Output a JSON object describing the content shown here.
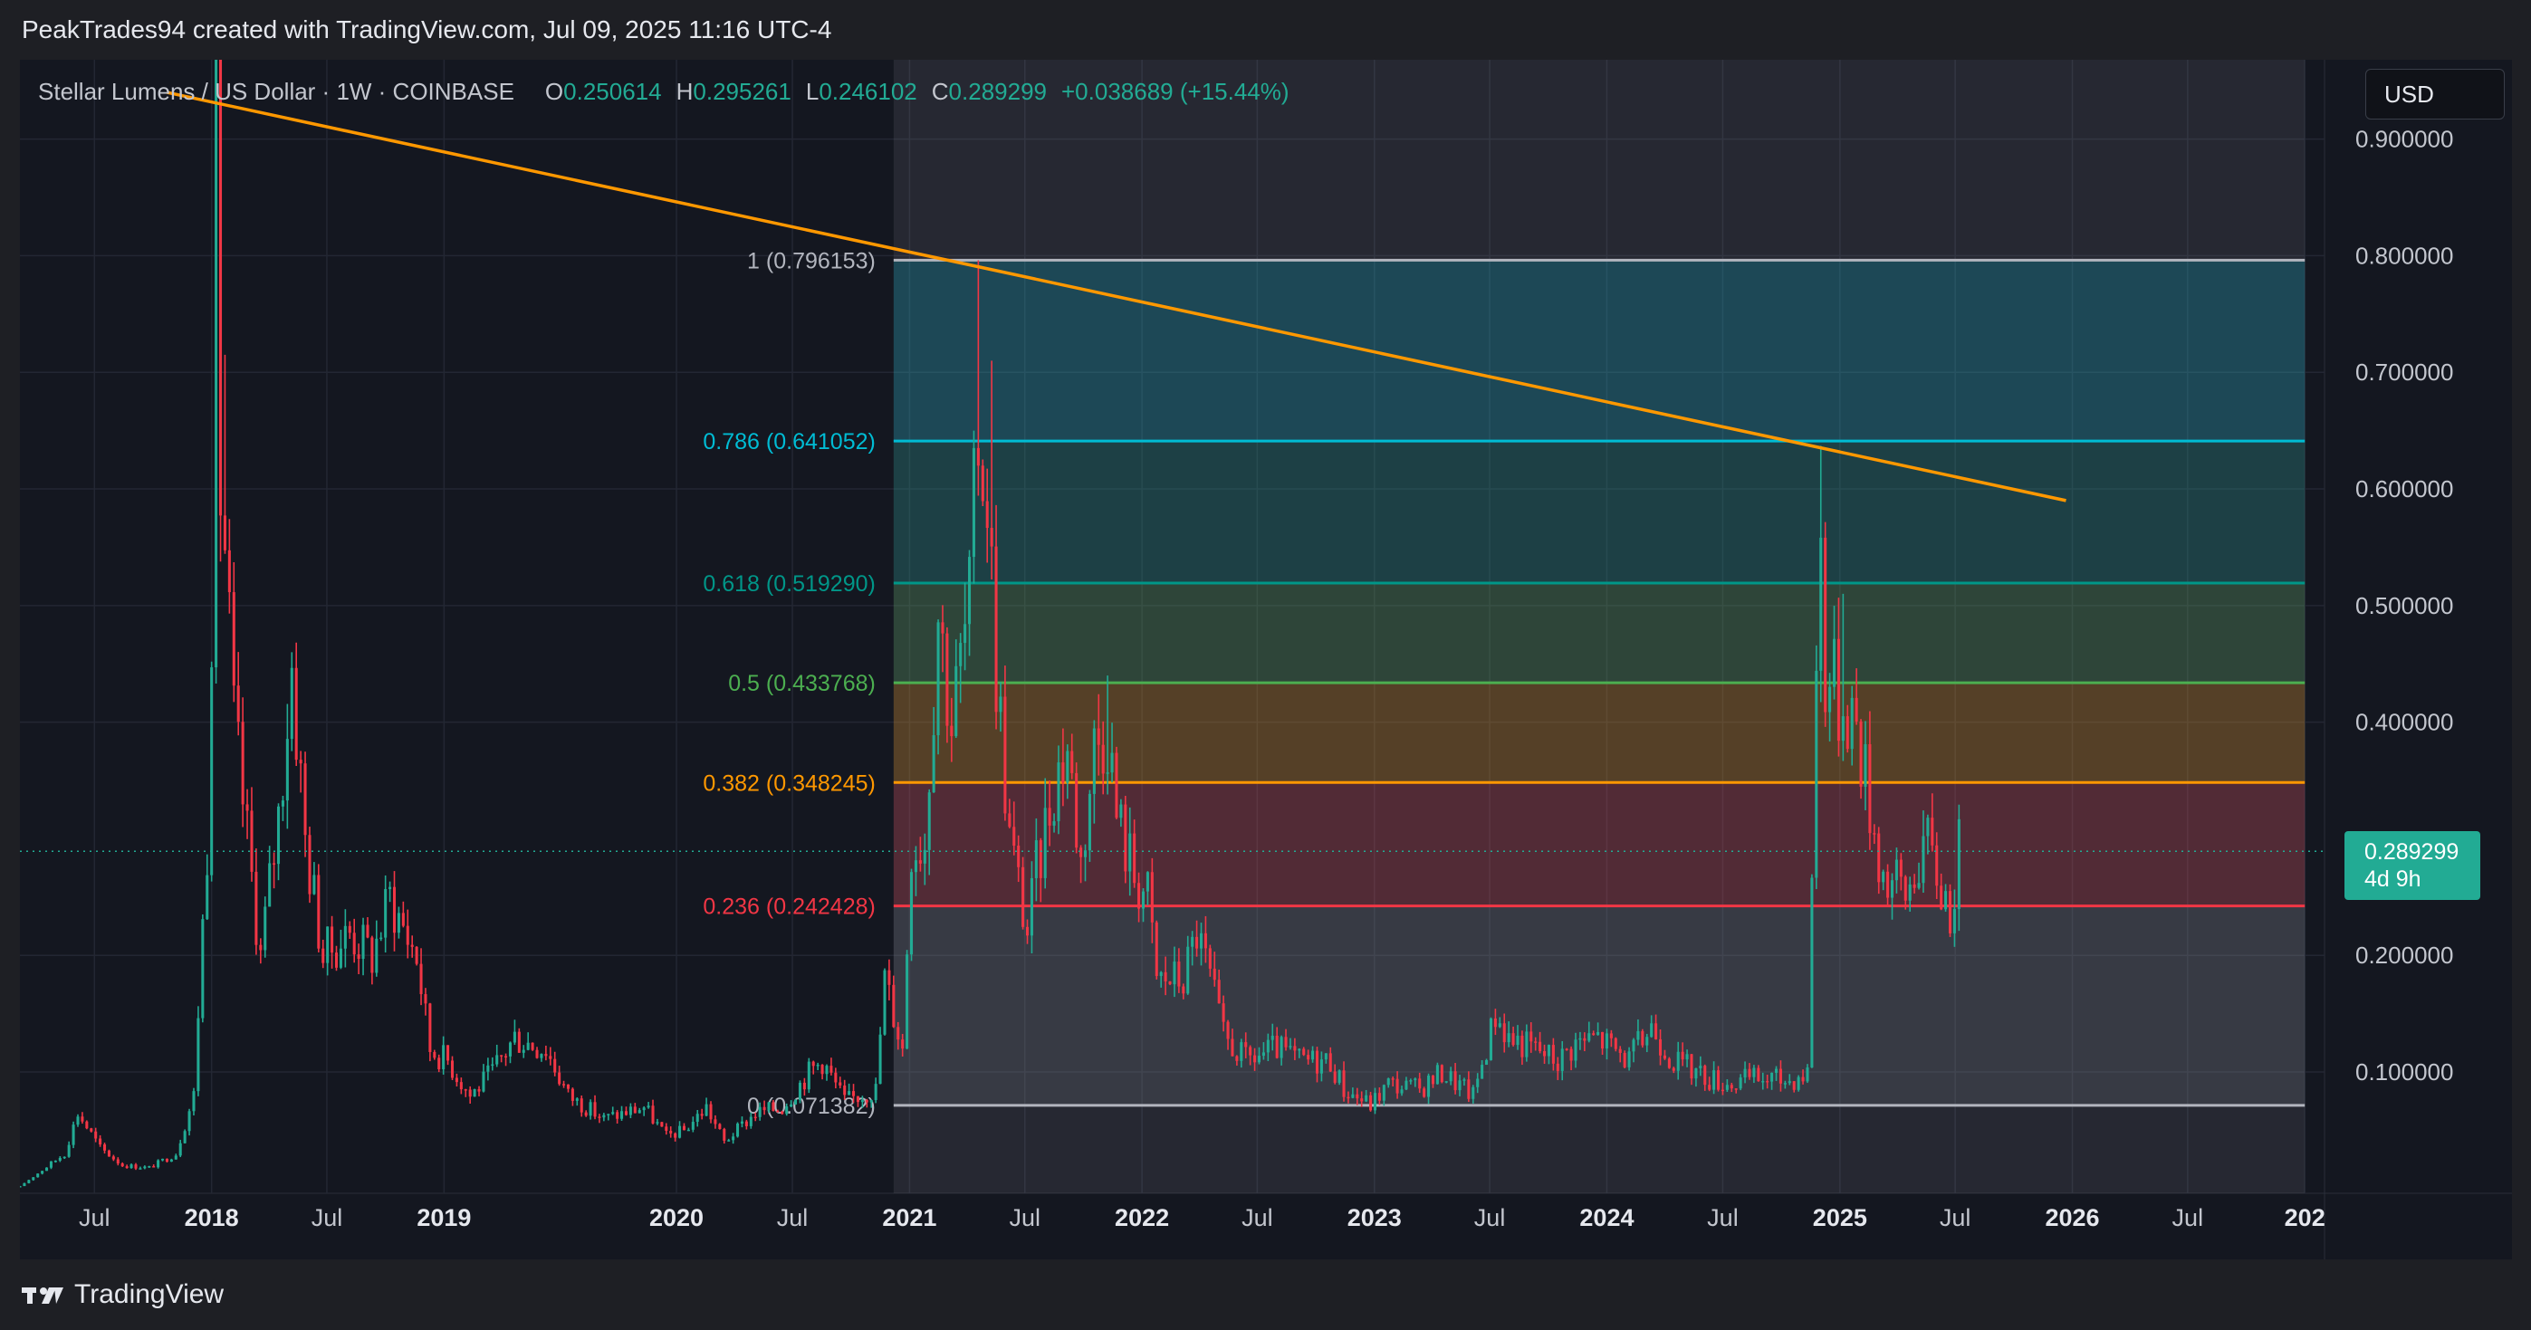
{
  "header": {
    "credit": "PeakTrades94 created with TradingView.com, Jul 09, 2025 11:16 UTC-4"
  },
  "legend": {
    "symbol": "Stellar Lumens / US Dollar · 1W · COINBASE",
    "o_label": "O",
    "o": "0.250614",
    "h_label": "H",
    "h": "0.295261",
    "l_label": "L",
    "l": "0.246102",
    "c_label": "C",
    "c": "0.289299",
    "change": "+0.038689 (+15.44%)"
  },
  "currency_button": "USD",
  "last_price": {
    "value": "0.289299",
    "countdown": "4d 9h"
  },
  "footer": {
    "brand": "TradingView"
  },
  "colors": {
    "up": "#22ab94",
    "down": "#f23645",
    "trendline": "#ff9800",
    "fib_1": "#b2b5be",
    "fib_786": "#00bcd4",
    "fib_618": "#009688",
    "fib_5": "#4caf50",
    "fib_382": "#ff9800",
    "fib_236": "#f23645",
    "fib_0": "#b2b5be"
  },
  "chart_data": {
    "type": "candlestick",
    "symbol": "XLMUSD",
    "interval": "1W",
    "exchange": "COINBASE",
    "y_axis": {
      "position": "right",
      "ticks": [
        "0.900000",
        "0.800000",
        "0.700000",
        "0.600000",
        "0.500000",
        "0.400000",
        "0.200000",
        "0.100000"
      ],
      "tick_values": [
        0.9,
        0.8,
        0.7,
        0.6,
        0.5,
        0.4,
        0.2,
        0.1
      ],
      "range": [
        -0.004,
        0.968
      ]
    },
    "x_axis": {
      "ticks": [
        {
          "label": "Jul",
          "date": "2017-07-01",
          "bold": false
        },
        {
          "label": "2018",
          "date": "2018-01-01",
          "bold": true
        },
        {
          "label": "Jul",
          "date": "2018-07-01",
          "bold": false
        },
        {
          "label": "2019",
          "date": "2019-01-01",
          "bold": true
        },
        {
          "label": "2020",
          "date": "2020-01-01",
          "bold": true
        },
        {
          "label": "Jul",
          "date": "2020-07-01",
          "bold": false
        },
        {
          "label": "2021",
          "date": "2021-01-01",
          "bold": true
        },
        {
          "label": "Jul",
          "date": "2021-07-01",
          "bold": false
        },
        {
          "label": "2022",
          "date": "2022-01-01",
          "bold": true
        },
        {
          "label": "Jul",
          "date": "2022-07-01",
          "bold": false
        },
        {
          "label": "2023",
          "date": "2023-01-01",
          "bold": true
        },
        {
          "label": "Jul",
          "date": "2023-07-01",
          "bold": false
        },
        {
          "label": "2024",
          "date": "2024-01-01",
          "bold": true
        },
        {
          "label": "Jul",
          "date": "2024-07-01",
          "bold": false
        },
        {
          "label": "2025",
          "date": "2025-01-01",
          "bold": true
        },
        {
          "label": "Jul",
          "date": "2025-07-01",
          "bold": false
        },
        {
          "label": "2026",
          "date": "2026-01-01",
          "bold": true
        },
        {
          "label": "Jul",
          "date": "2026-07-01",
          "bold": false
        },
        {
          "label": "202",
          "date": "2027-01-01",
          "bold": true
        }
      ],
      "range": [
        "2017-03-06",
        "2027-02-01"
      ]
    },
    "price_path": [
      [
        "2017-03-06",
        0.002
      ],
      [
        "2017-05-15",
        0.03
      ],
      [
        "2017-06-05",
        0.065
      ],
      [
        "2017-07-10",
        0.035
      ],
      [
        "2017-08-14",
        0.02
      ],
      [
        "2017-09-25",
        0.018
      ],
      [
        "2017-11-06",
        0.03
      ],
      [
        "2017-12-04",
        0.08
      ],
      [
        "2017-12-25",
        0.3
      ],
      [
        "2018-01-01",
        0.5
      ],
      [
        "2018-01-08",
        0.93
      ],
      [
        "2018-01-15",
        0.6
      ],
      [
        "2018-01-22",
        0.55
      ],
      [
        "2018-02-05",
        0.4
      ],
      [
        "2018-02-26",
        0.3
      ],
      [
        "2018-03-19",
        0.2
      ],
      [
        "2018-04-16",
        0.32
      ],
      [
        "2018-05-07",
        0.45
      ],
      [
        "2018-05-28",
        0.3
      ],
      [
        "2018-06-25",
        0.2
      ],
      [
        "2018-08-06",
        0.22
      ],
      [
        "2018-09-10",
        0.2
      ],
      [
        "2018-10-08",
        0.25
      ],
      [
        "2018-11-19",
        0.2
      ],
      [
        "2018-12-10",
        0.12
      ],
      [
        "2019-01-07",
        0.11
      ],
      [
        "2019-02-11",
        0.08
      ],
      [
        "2019-03-18",
        0.1
      ],
      [
        "2019-04-22",
        0.13
      ],
      [
        "2019-06-10",
        0.12
      ],
      [
        "2019-07-15",
        0.08
      ],
      [
        "2019-09-09",
        0.06
      ],
      [
        "2019-11-11",
        0.07
      ],
      [
        "2019-12-16",
        0.045
      ],
      [
        "2020-01-13",
        0.05
      ],
      [
        "2020-02-17",
        0.07
      ],
      [
        "2020-03-16",
        0.04
      ],
      [
        "2020-05-04",
        0.065
      ],
      [
        "2020-06-15",
        0.07
      ],
      [
        "2020-07-27",
        0.1
      ],
      [
        "2020-08-17",
        0.11
      ],
      [
        "2020-09-21",
        0.075
      ],
      [
        "2020-11-09",
        0.085
      ],
      [
        "2020-11-23",
        0.18
      ],
      [
        "2020-12-07",
        0.15
      ],
      [
        "2020-12-21",
        0.12
      ],
      [
        "2021-01-04",
        0.3
      ],
      [
        "2021-01-25",
        0.3
      ],
      [
        "2021-02-15",
        0.5
      ],
      [
        "2021-03-08",
        0.4
      ],
      [
        "2021-04-05",
        0.5
      ],
      [
        "2021-04-19",
        0.65
      ],
      [
        "2021-05-03",
        0.6
      ],
      [
        "2021-05-17",
        0.45
      ],
      [
        "2021-06-07",
        0.3
      ],
      [
        "2021-07-05",
        0.22
      ],
      [
        "2021-07-19",
        0.27
      ],
      [
        "2021-08-16",
        0.35
      ],
      [
        "2021-09-06",
        0.38
      ],
      [
        "2021-09-27",
        0.28
      ],
      [
        "2021-10-18",
        0.38
      ],
      [
        "2021-11-08",
        0.4
      ],
      [
        "2021-11-22",
        0.32
      ],
      [
        "2021-12-20",
        0.27
      ],
      [
        "2022-01-10",
        0.25
      ],
      [
        "2022-01-24",
        0.18
      ],
      [
        "2022-03-07",
        0.18
      ],
      [
        "2022-03-28",
        0.22
      ],
      [
        "2022-04-18",
        0.18
      ],
      [
        "2022-05-09",
        0.13
      ],
      [
        "2022-06-13",
        0.11
      ],
      [
        "2022-08-01",
        0.12
      ],
      [
        "2022-09-05",
        0.11
      ],
      [
        "2022-10-24",
        0.11
      ],
      [
        "2022-11-14",
        0.085
      ],
      [
        "2022-12-26",
        0.072
      ],
      [
        "2023-01-23",
        0.09
      ],
      [
        "2023-03-13",
        0.085
      ],
      [
        "2023-04-17",
        0.1
      ],
      [
        "2023-06-05",
        0.08
      ],
      [
        "2023-07-10",
        0.15
      ],
      [
        "2023-07-31",
        0.13
      ],
      [
        "2023-09-11",
        0.12
      ],
      [
        "2023-10-16",
        0.11
      ],
      [
        "2023-11-13",
        0.125
      ],
      [
        "2023-12-18",
        0.13
      ],
      [
        "2024-02-05",
        0.11
      ],
      [
        "2024-03-11",
        0.14
      ],
      [
        "2024-04-15",
        0.11
      ],
      [
        "2024-06-10",
        0.095
      ],
      [
        "2024-07-15",
        0.09
      ],
      [
        "2024-08-19",
        0.095
      ],
      [
        "2024-10-14",
        0.093
      ],
      [
        "2024-11-11",
        0.1
      ],
      [
        "2024-11-18",
        0.28
      ],
      [
        "2024-11-25",
        0.45
      ],
      [
        "2024-12-02",
        0.55
      ],
      [
        "2024-12-09",
        0.45
      ],
      [
        "2024-12-30",
        0.42
      ],
      [
        "2025-01-13",
        0.42
      ],
      [
        "2025-01-27",
        0.4
      ],
      [
        "2025-02-17",
        0.33
      ],
      [
        "2025-03-10",
        0.27
      ],
      [
        "2025-03-31",
        0.26
      ],
      [
        "2025-04-14",
        0.25
      ],
      [
        "2025-05-12",
        0.3
      ],
      [
        "2025-06-02",
        0.27
      ],
      [
        "2025-06-23",
        0.24
      ],
      [
        "2025-07-07",
        0.289
      ]
    ],
    "spike_highs": [
      [
        "2018-01-08",
        0.938
      ],
      [
        "2018-01-22",
        0.715
      ],
      [
        "2018-05-07",
        0.46
      ],
      [
        "2021-04-19",
        0.796
      ],
      [
        "2021-05-10",
        0.71
      ],
      [
        "2021-11-08",
        0.44
      ],
      [
        "2024-12-02",
        0.637
      ],
      [
        "2025-01-06",
        0.51
      ]
    ],
    "fibonacci_retracement": {
      "start_date": "2020-12-07",
      "end_date": "2027-01-01",
      "levels": [
        {
          "ratio": 1,
          "price": 0.796153,
          "label": "1 (0.796153)",
          "color": "#b2b5be",
          "fill": "#00bcd4"
        },
        {
          "ratio": 0.786,
          "price": 0.641052,
          "label": "0.786 (0.641052)",
          "color": "#00bcd4",
          "fill": "#00bcd4"
        },
        {
          "ratio": 0.618,
          "price": 0.51929,
          "label": "0.618 (0.519290)",
          "color": "#009688",
          "fill": "#009688"
        },
        {
          "ratio": 0.5,
          "price": 0.433768,
          "label": "0.5 (0.433768)",
          "color": "#4caf50",
          "fill": "#4caf50"
        },
        {
          "ratio": 0.382,
          "price": 0.348245,
          "label": "0.382 (0.348245)",
          "color": "#ff9800",
          "fill": "#ff9800"
        },
        {
          "ratio": 0.236,
          "price": 0.242428,
          "label": "0.236 (0.242428)",
          "color": "#f23645",
          "fill": "#f23645"
        },
        {
          "ratio": 0,
          "price": 0.071382,
          "label": "0 (0.071382)",
          "color": "#b2b5be",
          "fill": "#787b86"
        }
      ]
    },
    "trendline": {
      "color": "#ff9800",
      "points": [
        [
          "2017-10-23",
          0.94
        ],
        [
          "2025-12-22",
          0.59
        ]
      ]
    },
    "last_price": 0.289299,
    "last_price_line": {
      "style": "dotted",
      "color": "#22ab94"
    }
  }
}
